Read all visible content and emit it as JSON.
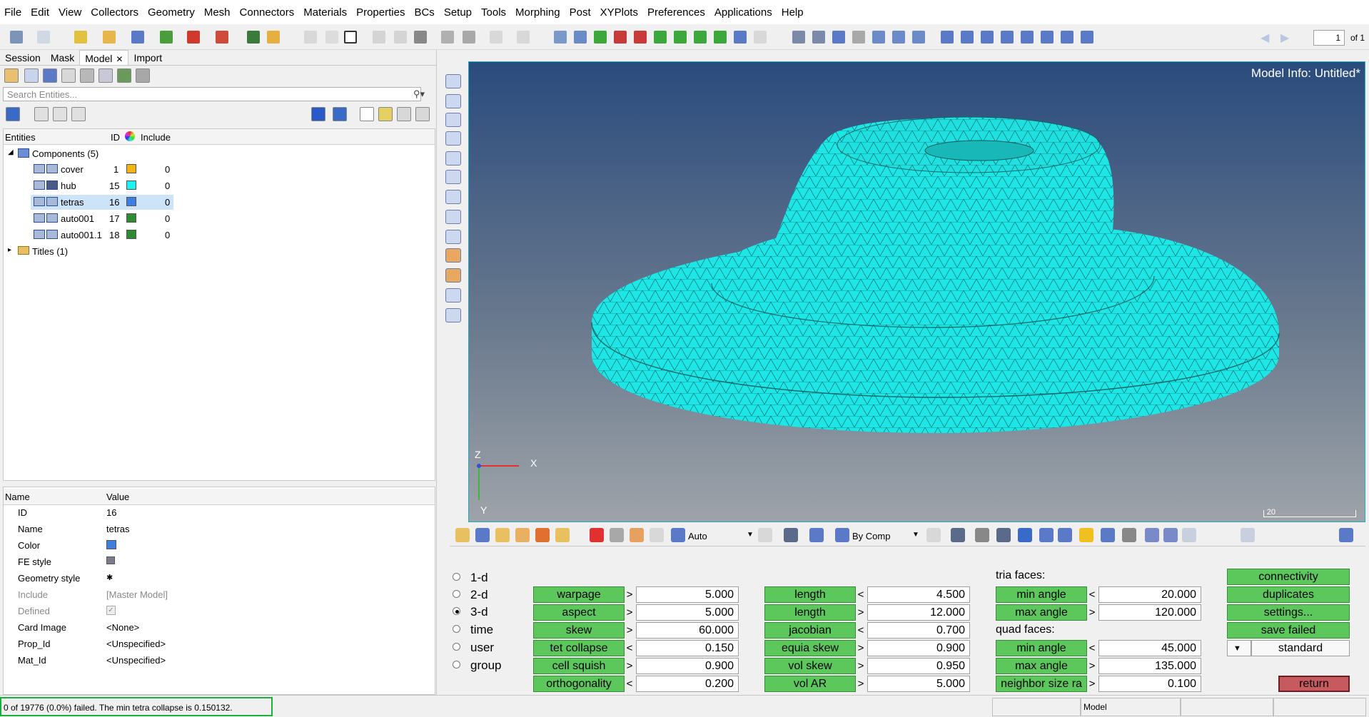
{
  "menu": [
    "File",
    "Edit",
    "View",
    "Collectors",
    "Geometry",
    "Mesh",
    "Connectors",
    "Materials",
    "Properties",
    "BCs",
    "Setup",
    "Tools",
    "Morphing",
    "Post",
    "XYPlots",
    "Preferences",
    "Applications",
    "Help"
  ],
  "pager": {
    "value": "1",
    "of_label": "of 1"
  },
  "tabs": [
    {
      "label": "Session",
      "closable": false,
      "active": false
    },
    {
      "label": "Mask",
      "closable": false,
      "active": false
    },
    {
      "label": "Model",
      "closable": true,
      "active": true
    },
    {
      "label": "Import",
      "closable": false,
      "active": false
    }
  ],
  "search": {
    "placeholder": "Search Entities..."
  },
  "tree": {
    "headers": {
      "entities": "Entities",
      "id": "ID",
      "include": "Include"
    },
    "components_label": "Components (5)",
    "titles_label": "Titles (1)",
    "components": [
      {
        "name": "cover",
        "id": "1",
        "color": "#f1b417",
        "include": "0",
        "selected": false
      },
      {
        "name": "hub",
        "id": "15",
        "color": "#1cf0f0",
        "include": "0",
        "selected": false
      },
      {
        "name": "tetras",
        "id": "16",
        "color": "#3f7de0",
        "include": "0",
        "selected": true
      },
      {
        "name": "auto001",
        "id": "17",
        "color": "#2f8a34",
        "include": "0",
        "selected": false
      },
      {
        "name": "auto001.1",
        "id": "18",
        "color": "#2f8a34",
        "include": "0",
        "selected": false
      }
    ]
  },
  "properties": {
    "headers": {
      "name": "Name",
      "value": "Value"
    },
    "rows": [
      {
        "name": "ID",
        "value": "16",
        "dim": false
      },
      {
        "name": "Name",
        "value": "tetras",
        "dim": false
      },
      {
        "name": "Color",
        "value": "",
        "dim": false
      },
      {
        "name": "FE style",
        "value": "",
        "dim": false
      },
      {
        "name": "Geometry style",
        "value": "",
        "dim": false
      },
      {
        "name": "Include",
        "value": "[Master Model]",
        "dim": true
      },
      {
        "name": "Defined",
        "value": "",
        "dim": true
      },
      {
        "name": "Card Image",
        "value": "<None>",
        "dim": false
      },
      {
        "name": "Prop_Id",
        "value": "<Unspecified>",
        "dim": false
      },
      {
        "name": "Mat_Id",
        "value": "<Unspecified>",
        "dim": false
      }
    ]
  },
  "viewport": {
    "model_info": "Model Info: Untitled*",
    "scale_label": "20",
    "axis_x": "X",
    "axis_y": "Y",
    "axis_z": "Z",
    "mesh_color": "#1de6e6"
  },
  "viewbar": {
    "auto_label": "Auto",
    "bycomp_label": "By Comp"
  },
  "check_panel": {
    "modes": [
      {
        "label": "1-d",
        "selected": false
      },
      {
        "label": "2-d",
        "selected": false
      },
      {
        "label": "3-d",
        "selected": true
      },
      {
        "label": "time",
        "selected": false
      },
      {
        "label": "user",
        "selected": false
      },
      {
        "label": "group",
        "selected": false
      }
    ],
    "col1": [
      {
        "label": "warpage",
        "op": ">",
        "value": "5.000"
      },
      {
        "label": "aspect",
        "op": ">",
        "value": "5.000"
      },
      {
        "label": "skew",
        "op": ">",
        "value": "60.000"
      },
      {
        "label": "tet collapse",
        "op": "<",
        "value": "0.150"
      },
      {
        "label": "cell squish",
        "op": ">",
        "value": "0.900"
      },
      {
        "label": "orthogonality",
        "op": "<",
        "value": "0.200"
      }
    ],
    "col2": [
      {
        "label": "length",
        "op": "<",
        "value": "4.500"
      },
      {
        "label": "length",
        "op": ">",
        "value": "12.000"
      },
      {
        "label": "jacobian",
        "op": "<",
        "value": "0.700"
      },
      {
        "label": "equia skew",
        "op": ">",
        "value": "0.900"
      },
      {
        "label": "vol skew",
        "op": ">",
        "value": "0.950"
      },
      {
        "label": "vol AR",
        "op": ">",
        "value": "5.000"
      }
    ],
    "tria_label": "tria faces:",
    "quad_label": "quad faces:",
    "tria": [
      {
        "label": "min angle",
        "op": "<",
        "value": "20.000"
      },
      {
        "label": "max angle",
        "op": ">",
        "value": "120.000"
      }
    ],
    "quad": [
      {
        "label": "min angle",
        "op": "<",
        "value": "45.000"
      },
      {
        "label": "max angle",
        "op": ">",
        "value": "135.000"
      },
      {
        "label": "neighbor size ra",
        "op": ">",
        "value": "0.100"
      }
    ],
    "actions": [
      "connectivity",
      "duplicates",
      "settings...",
      "save failed"
    ],
    "dropdown_value": "standard",
    "return_label": "return"
  },
  "status": {
    "message": "0 of 19776 (0.0%) failed.  The min tetra collapse is 0.150132.",
    "model_label": "Model"
  },
  "colors": {
    "accent_green": "#5cc85c",
    "return_red": "#c65a5f",
    "selection": "#cce3f8"
  }
}
